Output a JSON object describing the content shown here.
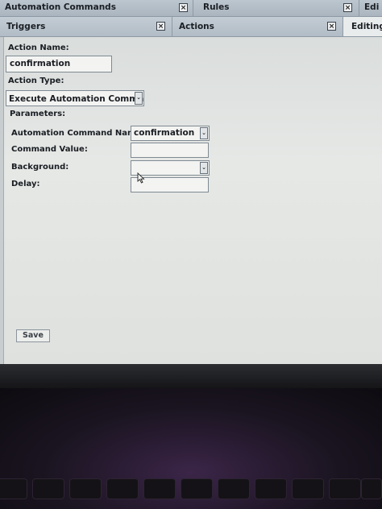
{
  "tabs_top": [
    {
      "label": "Automation Commands",
      "close": "×"
    },
    {
      "label": "Rules",
      "close": "×"
    },
    {
      "label": "Edi"
    }
  ],
  "tabs_second": [
    {
      "label": "Triggers",
      "close": "×"
    },
    {
      "label": "Actions",
      "close": "×"
    },
    {
      "label": "Editing"
    }
  ],
  "form": {
    "action_name_label": "Action Name:",
    "action_name_value": "confirmation",
    "action_type_label": "Action Type:",
    "action_type_value": "Execute Automation Command",
    "parameters_label": "Parameters:",
    "automation_command_name_label": "Automation Command Name:",
    "automation_command_name_value": "confirmation",
    "command_value_label": "Command Value:",
    "command_value_value": "",
    "background_label": "Background:",
    "background_value": "",
    "delay_label": "Delay:",
    "delay_value": "",
    "dropdown_glyph": "⌄"
  },
  "save_label": "Save",
  "colors": {
    "tab_bg": "#aab5bf",
    "active_tab_bg": "#e9ecec",
    "panel_bg": "#e6e8e6"
  }
}
